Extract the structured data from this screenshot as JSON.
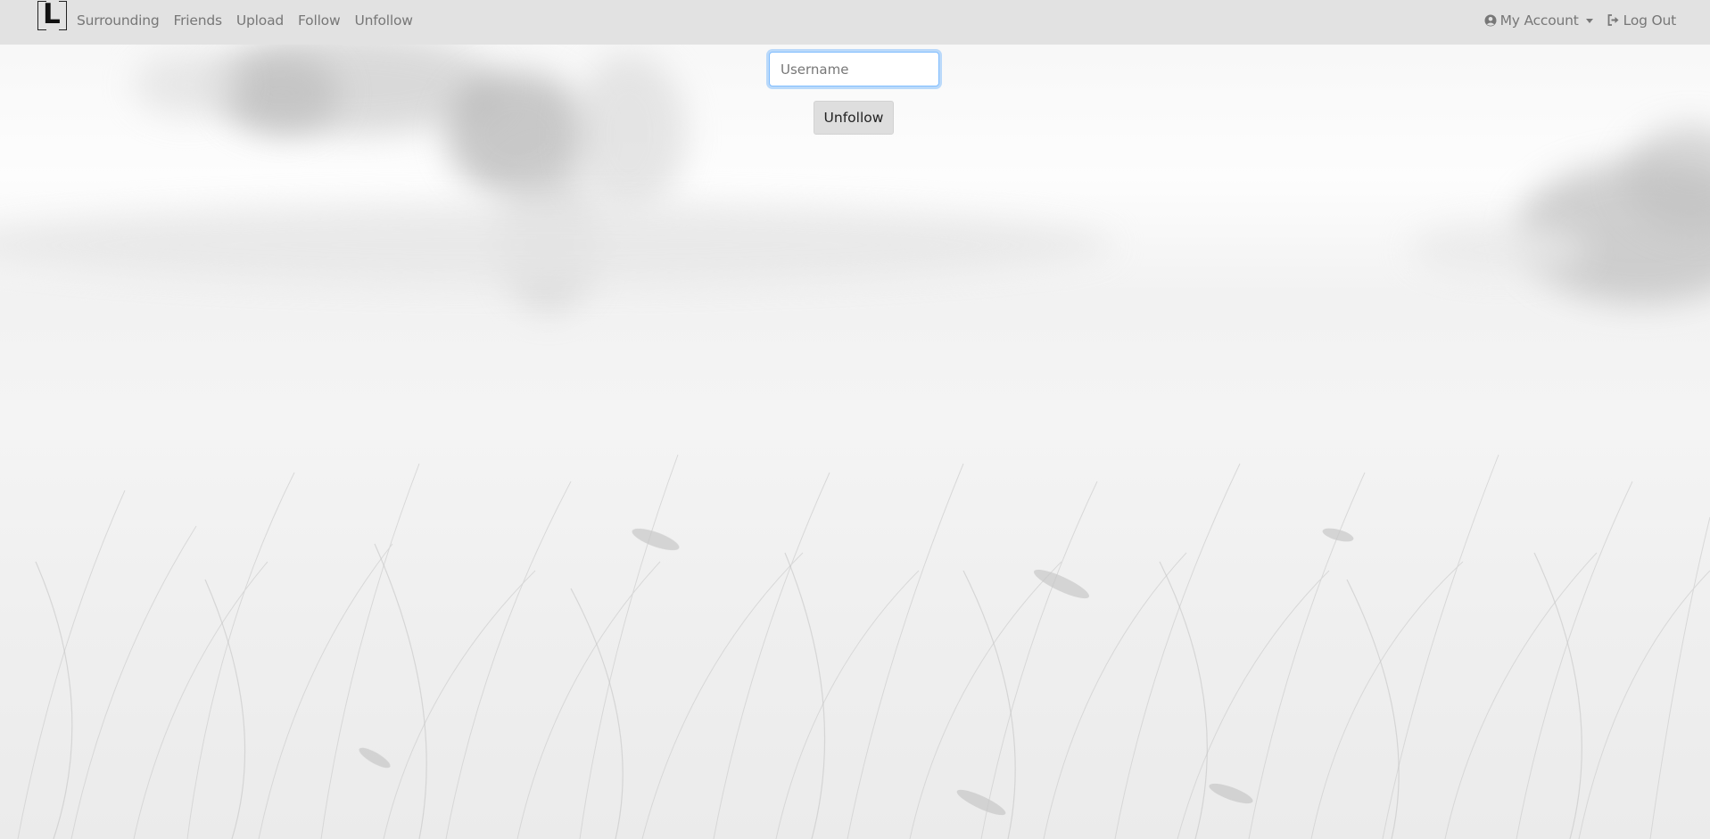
{
  "navbar": {
    "brand": {
      "letter": "L"
    },
    "links": [
      "Surrounding",
      "Friends",
      "Upload",
      "Follow",
      "Unfollow"
    ],
    "account": {
      "label": "My Account",
      "icon": "user-circle-icon"
    },
    "logout": {
      "label": "Log Out",
      "icon": "sign-out-icon"
    }
  },
  "form": {
    "username": {
      "placeholder": "Username",
      "value": ""
    },
    "submit_label": "Unfollow"
  },
  "colors": {
    "navbar_bg": "#e2e2e2",
    "nav_text": "#777777",
    "input_focus_border": "#80bdff",
    "button_bg": "#dedede"
  }
}
